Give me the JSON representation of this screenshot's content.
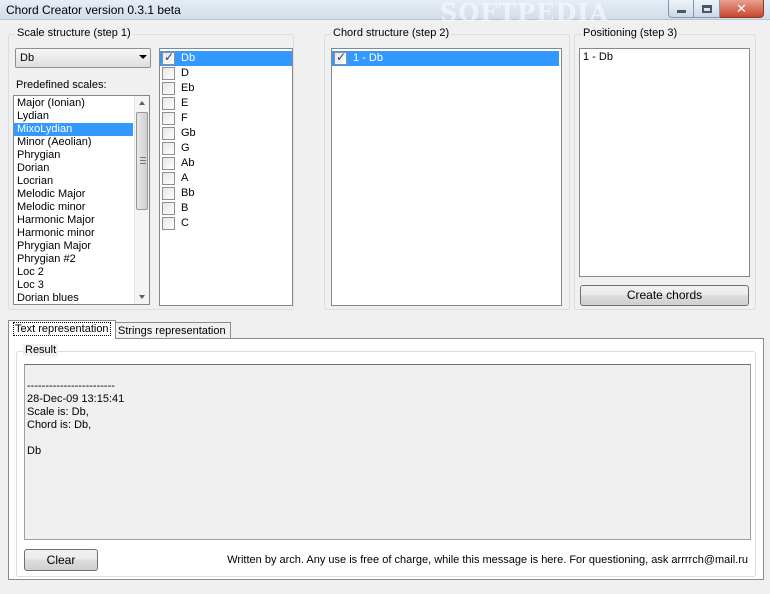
{
  "window": {
    "title": "Chord Creator version 0.3.1 beta",
    "watermark": "SOFTPEDIA"
  },
  "scale_group": {
    "label": "Scale structure (step 1)",
    "root_select": "Db",
    "predefined_label": "Predefined scales:",
    "scales": [
      "Major (Ionian)",
      "Lydian",
      "MixoLydian",
      "Minor (Aeolian)",
      "Phrygian",
      "Dorian",
      "Locrian",
      "Melodic Major",
      "Melodic minor",
      "Harmonic Major",
      "Harmonic minor",
      "Phrygian Major",
      "Phrygian #2",
      "Loc 2",
      "Loc 3",
      "Dorian blues"
    ],
    "selected_scale": "MixoLydian",
    "notes": [
      {
        "label": "Db",
        "checked": true
      },
      {
        "label": "D",
        "checked": false
      },
      {
        "label": "Eb",
        "checked": false
      },
      {
        "label": "E",
        "checked": false
      },
      {
        "label": "F",
        "checked": false
      },
      {
        "label": "Gb",
        "checked": false
      },
      {
        "label": "G",
        "checked": false
      },
      {
        "label": "Ab",
        "checked": false
      },
      {
        "label": "A",
        "checked": false
      },
      {
        "label": "Bb",
        "checked": false
      },
      {
        "label": "B",
        "checked": false
      },
      {
        "label": "C",
        "checked": false
      }
    ]
  },
  "chord_group": {
    "label": "Chord structure (step 2)",
    "items": [
      {
        "label": "1 - Db",
        "checked": true
      }
    ]
  },
  "positioning_group": {
    "label": "Positioning (step 3)",
    "items": [
      "1 - Db"
    ],
    "create_button": "Create chords"
  },
  "tabs": [
    {
      "label": "Text representation",
      "active": true
    },
    {
      "label": "Strings representation",
      "active": false
    }
  ],
  "result": {
    "label": "Result",
    "lines": [
      "",
      "------------------------",
      "28-Dec-09 13:15:41",
      "Scale is: Db,",
      "Chord is: Db,",
      "",
      "Db"
    ]
  },
  "footer": {
    "clear_button": "Clear",
    "credit": "Written by arch. Any use is free of charge, while this message is here. For questioning, ask arrrrch@mail.ru"
  },
  "colors": {
    "selection": "#3399ff",
    "window_bg": "#f0f0f0"
  }
}
